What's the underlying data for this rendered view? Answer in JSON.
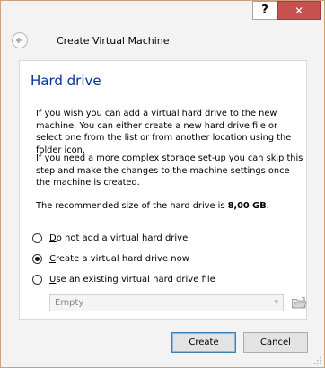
{
  "window": {
    "help_label": "?",
    "close_label": "✕",
    "title": "Create Virtual Machine"
  },
  "icons": {
    "back": "back-arrow-icon",
    "close": "close-icon",
    "help": "help-icon",
    "folder": "folder-icon",
    "dropdown": "chevron-down-icon"
  },
  "section": {
    "title": "Hard drive",
    "para1": "If you wish you can add a virtual hard drive to the new machine. You can either create a new hard drive file or select one from the list or from another location using the folder icon.",
    "para2": "If you need a more complex storage set-up you can skip this step and make the changes to the machine settings once the machine is created.",
    "para3_prefix": "The recommended size of the hard drive is ",
    "para3_value": "8,00 GB",
    "para3_suffix": "."
  },
  "options": [
    {
      "mnemonic": "D",
      "rest": "o not add a virtual hard drive",
      "selected": false
    },
    {
      "mnemonic": "C",
      "rest": "reate a virtual hard drive now",
      "selected": true
    },
    {
      "mnemonic": "U",
      "rest": "se an existing virtual hard drive file",
      "selected": false
    }
  ],
  "existing_drive": {
    "selected_value": "Empty",
    "enabled": false
  },
  "buttons": {
    "create": "Create",
    "cancel": "Cancel"
  },
  "colors": {
    "title_blue": "#003399",
    "close_red": "#c75050",
    "frame_border": "#c9a27b"
  }
}
